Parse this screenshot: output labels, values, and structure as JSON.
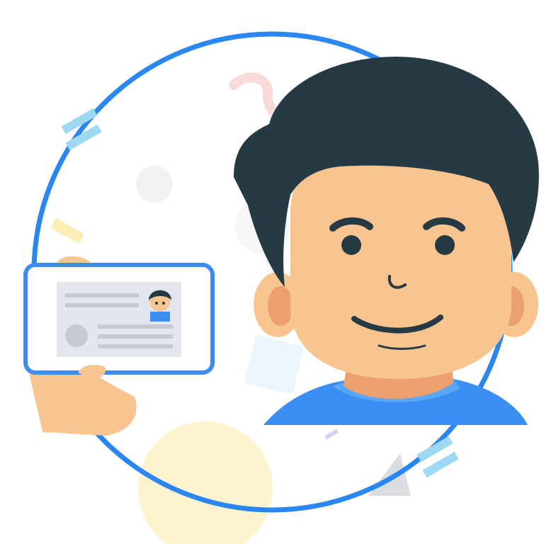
{
  "colors": {
    "ring": "#2a86f0",
    "tape": "#9fd8f2",
    "skin": "#f8c490",
    "skin_shadow": "#eba06e",
    "hair": "#263a44",
    "shirt": "#3d8ef2",
    "shirt_light": "#5aa6f7",
    "card_frame": "#ffffff",
    "card_border": "#3e8cf0",
    "card_panel": "#e3e7ed",
    "card_lines": "#c5cad4",
    "bg_yellow": "#fdf4cf",
    "bg_gray": "#f0f1f3",
    "bg_pink": "#f8dada"
  },
  "icons": [
    "id-card-icon",
    "avatar-illustration",
    "hand-illustration",
    "decorative-ring"
  ]
}
